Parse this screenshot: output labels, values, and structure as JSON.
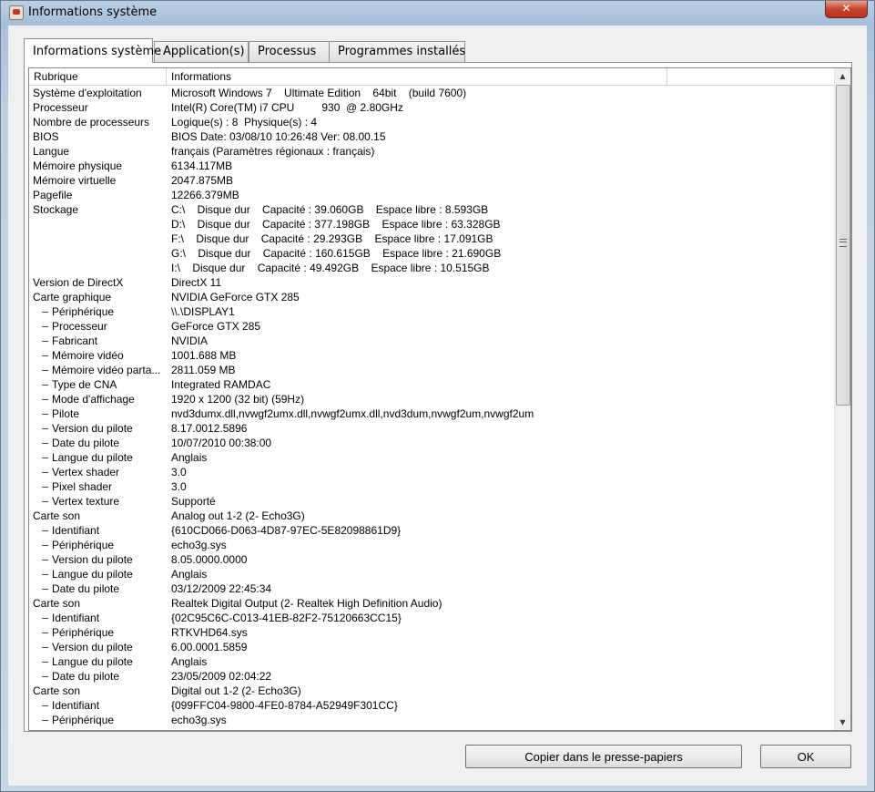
{
  "window": {
    "title": "Informations système",
    "close_label": "✕"
  },
  "tabs": [
    {
      "label": "Informations système",
      "active": true
    },
    {
      "label": "Application(s)",
      "active": false
    },
    {
      "label": "Processus",
      "active": false
    },
    {
      "label": "Programmes installés",
      "active": false
    }
  ],
  "table": {
    "columns": [
      "Rubrique",
      "Informations"
    ],
    "rows": [
      {
        "name": "Système d'exploitation",
        "value": "Microsoft Windows 7    Ultimate Edition    64bit    (build 7600)",
        "child": false
      },
      {
        "name": "Processeur",
        "value": "Intel(R) Core(TM) i7 CPU         930  @ 2.80GHz",
        "child": false
      },
      {
        "name": "Nombre de processeurs",
        "value": "Logique(s) : 8  Physique(s) : 4",
        "child": false
      },
      {
        "name": "BIOS",
        "value": "BIOS Date: 03/08/10 10:26:48 Ver: 08.00.15",
        "child": false
      },
      {
        "name": "Langue",
        "value": "français (Paramètres régionaux : français)",
        "child": false
      },
      {
        "name": "Mémoire physique",
        "value": "6134.117MB",
        "child": false
      },
      {
        "name": "Mémoire virtuelle",
        "value": "2047.875MB",
        "child": false
      },
      {
        "name": "Pagefile",
        "value": "12266.379MB",
        "child": false
      },
      {
        "name": "Stockage",
        "value": "C:\\    Disque dur    Capacité : 39.060GB    Espace libre : 8.593GB",
        "child": false
      },
      {
        "name": "",
        "value": "D:\\    Disque dur    Capacité : 377.198GB    Espace libre : 63.328GB",
        "child": false
      },
      {
        "name": "",
        "value": "F:\\    Disque dur    Capacité : 29.293GB    Espace libre : 17.091GB",
        "child": false
      },
      {
        "name": "",
        "value": "G:\\    Disque dur    Capacité : 160.615GB    Espace libre : 21.690GB",
        "child": false
      },
      {
        "name": "",
        "value": "I:\\    Disque dur    Capacité : 49.492GB    Espace libre : 10.515GB",
        "child": false
      },
      {
        "name": "Version de DirectX",
        "value": "DirectX 11",
        "child": false
      },
      {
        "name": "Carte graphique",
        "value": "NVIDIA GeForce GTX 285",
        "child": false
      },
      {
        "name": "Périphérique",
        "value": "\\\\.\\DISPLAY1",
        "child": true
      },
      {
        "name": "Processeur",
        "value": "GeForce GTX 285",
        "child": true
      },
      {
        "name": "Fabricant",
        "value": "NVIDIA",
        "child": true
      },
      {
        "name": "Mémoire vidéo",
        "value": "1001.688 MB",
        "child": true
      },
      {
        "name": "Mémoire vidéo parta...",
        "value": "2811.059 MB",
        "child": true
      },
      {
        "name": "Type de CNA",
        "value": "Integrated RAMDAC",
        "child": true
      },
      {
        "name": "Mode d'affichage",
        "value": "1920 x 1200 (32 bit) (59Hz)",
        "child": true
      },
      {
        "name": "Pilote",
        "value": "nvd3dumx.dll,nvwgf2umx.dll,nvwgf2umx.dll,nvd3dum,nvwgf2um,nvwgf2um",
        "child": true
      },
      {
        "name": "Version du pilote",
        "value": "8.17.0012.5896",
        "child": true
      },
      {
        "name": "Date du pilote",
        "value": "10/07/2010 00:38:00",
        "child": true
      },
      {
        "name": "Langue du pilote",
        "value": "Anglais",
        "child": true
      },
      {
        "name": "Vertex shader",
        "value": "3.0",
        "child": true
      },
      {
        "name": "Pixel shader",
        "value": "3.0",
        "child": true
      },
      {
        "name": "Vertex texture",
        "value": "Supporté",
        "child": true
      },
      {
        "name": "Carte son",
        "value": "Analog out 1-2 (2- Echo3G)",
        "child": false
      },
      {
        "name": "Identifiant",
        "value": "{610CD066-D063-4D87-97EC-5E82098861D9}",
        "child": true
      },
      {
        "name": "Périphérique",
        "value": "echo3g.sys",
        "child": true
      },
      {
        "name": "Version du pilote",
        "value": "8.05.0000.0000",
        "child": true
      },
      {
        "name": "Langue du pilote",
        "value": "Anglais",
        "child": true
      },
      {
        "name": "Date du pilote",
        "value": "03/12/2009 22:45:34",
        "child": true
      },
      {
        "name": "Carte son",
        "value": "Realtek Digital Output (2- Realtek High Definition Audio)",
        "child": false
      },
      {
        "name": "Identifiant",
        "value": "{02C95C6C-C013-41EB-82F2-75120663CC15}",
        "child": true
      },
      {
        "name": "Périphérique",
        "value": "RTKVHD64.sys",
        "child": true
      },
      {
        "name": "Version du pilote",
        "value": "6.00.0001.5859",
        "child": true
      },
      {
        "name": "Langue du pilote",
        "value": "Anglais",
        "child": true
      },
      {
        "name": "Date du pilote",
        "value": "23/05/2009 02:04:22",
        "child": true
      },
      {
        "name": "Carte son",
        "value": "Digital out 1-2 (2- Echo3G)",
        "child": false
      },
      {
        "name": "Identifiant",
        "value": "{099FFC04-9800-4FE0-8784-A52949F301CC}",
        "child": true
      },
      {
        "name": "Périphérique",
        "value": "echo3g.sys",
        "child": true
      }
    ]
  },
  "scrollbar": {
    "up_arrow": "▲",
    "down_arrow": "▼"
  },
  "buttons": {
    "copy_label": "Copier dans le presse-papiers",
    "ok_label": "OK"
  }
}
